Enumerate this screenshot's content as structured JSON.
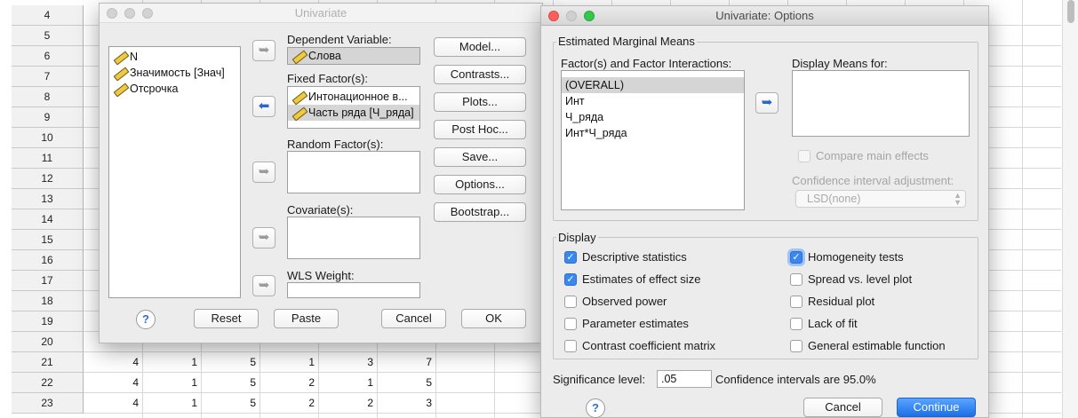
{
  "spreadsheet": {
    "row_numbers": [
      "4",
      "5",
      "6",
      "7",
      "8",
      "9",
      "10",
      "11",
      "12",
      "13",
      "14",
      "15",
      "16",
      "17",
      "18",
      "19",
      "20",
      "21",
      "22",
      "23"
    ],
    "rows_data": [
      {
        "row": "21",
        "cells": [
          "4",
          "1",
          "5",
          "1",
          "3",
          "7"
        ]
      },
      {
        "row": "22",
        "cells": [
          "4",
          "1",
          "5",
          "2",
          "1",
          "5"
        ]
      },
      {
        "row": "23",
        "cells": [
          "4",
          "1",
          "5",
          "2",
          "2",
          "3"
        ]
      }
    ]
  },
  "univariate": {
    "title": "Univariate",
    "source_vars": [
      "N",
      "Значимость [Знач]",
      "Отсрочка"
    ],
    "dependent_label": "Dependent Variable:",
    "dependent_value": "Слова",
    "fixed_label": "Fixed Factor(s):",
    "fixed_items": [
      "Интонационное в...",
      "Часть ряда [Ч_ряда]"
    ],
    "random_label": "Random Factor(s):",
    "covariate_label": "Covariate(s):",
    "wls_label": "WLS Weight:",
    "buttons": {
      "model": "Model...",
      "contrasts": "Contrasts...",
      "plots": "Plots...",
      "posthoc": "Post Hoc...",
      "save": "Save...",
      "options": "Options...",
      "bootstrap": "Bootstrap...",
      "help": "?",
      "reset": "Reset",
      "paste": "Paste",
      "cancel": "Cancel",
      "ok": "OK"
    },
    "arrow_icon": "➥",
    "arrow_back_icon": "⬅"
  },
  "options": {
    "title": "Univariate: Options",
    "emm_group": "Estimated Marginal Means",
    "factors_label": "Factor(s) and Factor Interactions:",
    "factors": [
      "(OVERALL)",
      "Инт",
      "Ч_ряда",
      "Инт*Ч_ряда"
    ],
    "display_means_label": "Display Means for:",
    "compare_main_effects": "Compare main effects",
    "ci_adjust_label": "Confidence interval adjustment:",
    "ci_adjust_value": "LSD(none)",
    "display_group": "Display",
    "checks_left": [
      {
        "label": "Descriptive statistics",
        "checked": true
      },
      {
        "label": "Estimates of effect size",
        "checked": true
      },
      {
        "label": "Observed power",
        "checked": false
      },
      {
        "label": "Parameter estimates",
        "checked": false
      },
      {
        "label": "Contrast coefficient matrix",
        "checked": false
      }
    ],
    "checks_right": [
      {
        "label": "Homogeneity tests",
        "checked": true
      },
      {
        "label": "Spread vs. level plot",
        "checked": false
      },
      {
        "label": "Residual plot",
        "checked": false
      },
      {
        "label": "Lack of fit",
        "checked": false
      },
      {
        "label": "General estimable function",
        "checked": false
      }
    ],
    "significance_label": "Significance level:",
    "significance_value": ".05",
    "ci_text": "Confidence intervals are 95.0%",
    "buttons": {
      "help": "?",
      "cancel": "Cancel",
      "continue": "Continue"
    },
    "accent_color": "#1c6fe6"
  }
}
